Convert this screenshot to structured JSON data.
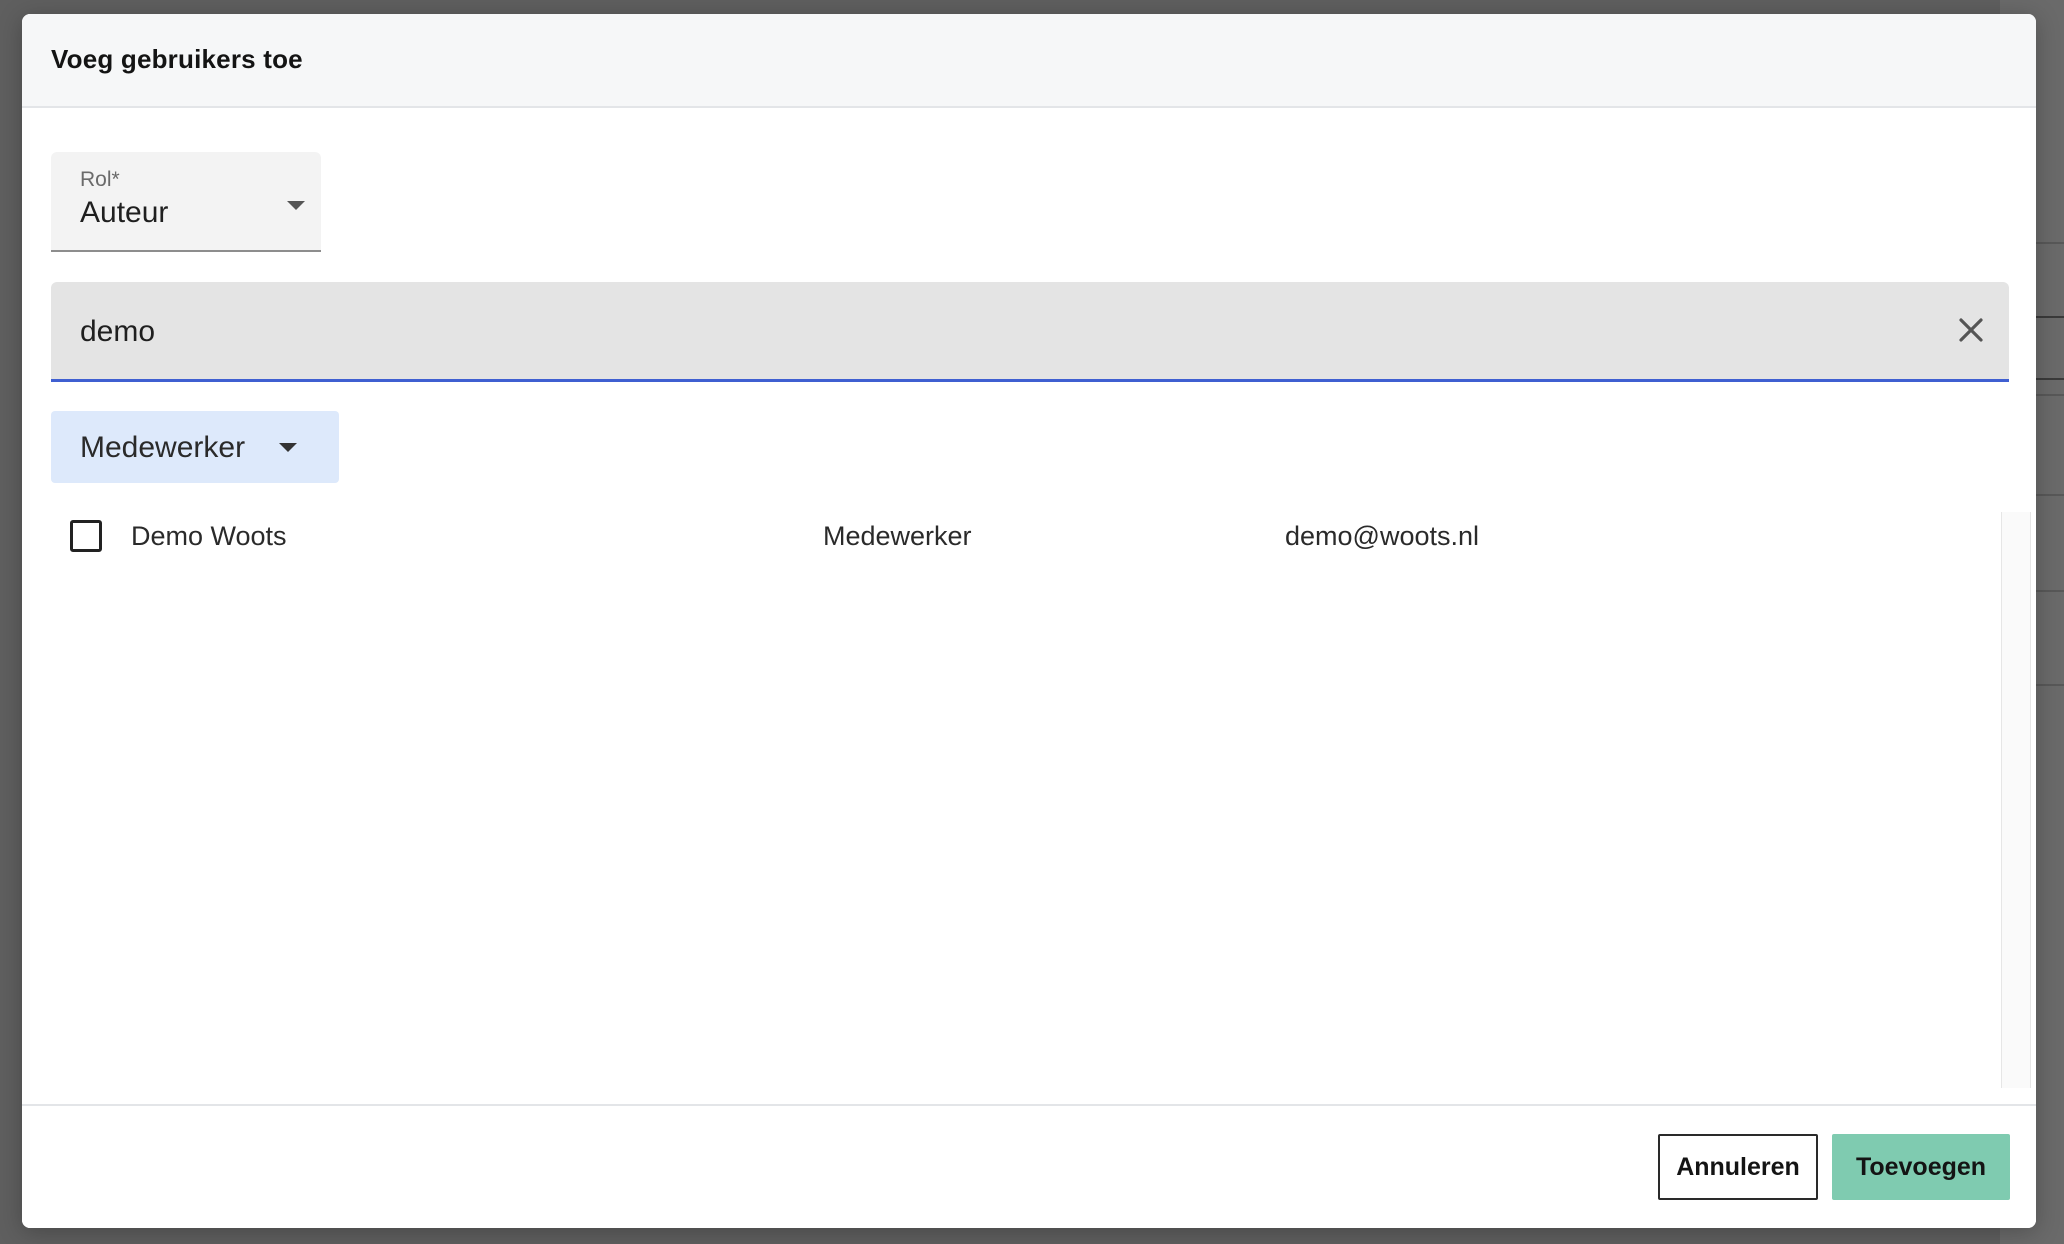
{
  "modal": {
    "title": "Voeg gebruikers toe"
  },
  "role_select": {
    "label": "Rol*",
    "value": "Auteur"
  },
  "search": {
    "value": "demo"
  },
  "type_filter": {
    "label": "Medewerker"
  },
  "results": [
    {
      "name": "Demo Woots",
      "type": "Medewerker",
      "email": "demo@woots.nl",
      "checked": false
    }
  ],
  "footer": {
    "cancel_label": "Annuleren",
    "add_label": "Toevoegen"
  },
  "colors": {
    "accent_underline": "#3f5fd1",
    "primary_button": "#7fcbb0",
    "chip_background": "#dde9fb"
  },
  "icons": {
    "clear": "close-icon",
    "role_caret": "chevron-down-icon",
    "filter_caret": "chevron-down-icon"
  }
}
